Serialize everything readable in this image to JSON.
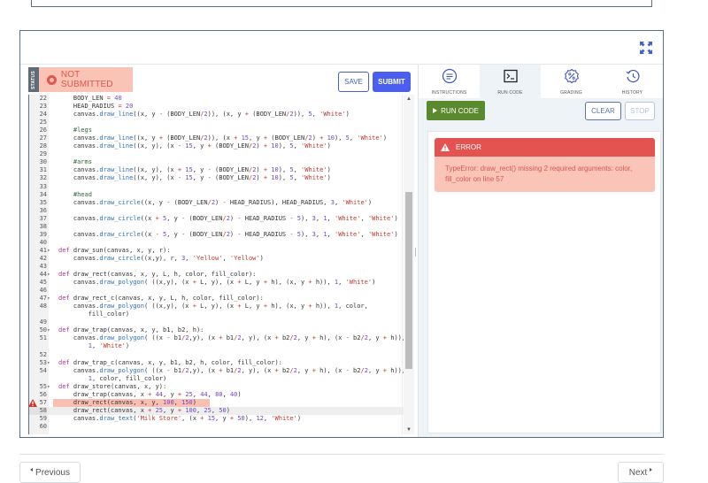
{
  "workspace": {
    "expand_icon": "expand-arrows-icon"
  },
  "editor": {
    "status_label": "STATUS",
    "status_text": "NOT SUBMITTED",
    "save_label": "SAVE",
    "submit_label": "SUBMIT",
    "error_line": 57,
    "active_line": 58,
    "lines": [
      {
        "n": "22",
        "fold": false,
        "html": "    BODY_LEN <span class='op'>=</span> <span class='num'>40</span>"
      },
      {
        "n": "23",
        "fold": false,
        "html": "    HEAD_RADIUS <span class='op'>=</span> <span class='num'>20</span>"
      },
      {
        "n": "24",
        "fold": false,
        "html": "    canvas.<span class='fn'>draw_line</span>((x, y <span class='op'>-</span> (BODY_LEN<span class='op'>/</span><span class='num'>2</span>)), (x, y <span class='op'>+</span> (BODY_LEN<span class='op'>/</span><span class='num'>2</span>)), <span class='num'>5</span>, <span class='str'>'White'</span>)"
      },
      {
        "n": "25",
        "fold": false,
        "html": ""
      },
      {
        "n": "26",
        "fold": false,
        "html": "    <span class='cm'>#legs</span>"
      },
      {
        "n": "27",
        "fold": false,
        "html": "    canvas.<span class='fn'>draw_line</span>((x, y <span class='op'>+</span> (BODY_LEN<span class='op'>/</span><span class='num'>2</span>)), (x <span class='op'>+</span> <span class='num'>15</span>, y <span class='op'>+</span> (BODY_LEN<span class='op'>/</span><span class='num'>2</span>) <span class='op'>+</span> <span class='num'>10</span>), <span class='num'>5</span>, <span class='str'>'White'</span>)"
      },
      {
        "n": "28",
        "fold": false,
        "html": "    canvas.<span class='fn'>draw_line</span>((x, y), (x <span class='op'>-</span> <span class='num'>15</span>, y <span class='op'>+</span> (BODY_LEN<span class='op'>/</span><span class='num'>2</span>) <span class='op'>+</span> <span class='num'>10</span>), <span class='num'>5</span>, <span class='str'>'White'</span>)"
      },
      {
        "n": "29",
        "fold": false,
        "html": ""
      },
      {
        "n": "30",
        "fold": false,
        "html": "    <span class='cm'>#arms</span>"
      },
      {
        "n": "31",
        "fold": false,
        "html": "    canvas.<span class='fn'>draw_line</span>((x, y), (x <span class='op'>+</span> <span class='num'>15</span>, y <span class='op'>-</span> (BODY_LEN<span class='op'>/</span><span class='num'>2</span>) <span class='op'>+</span> <span class='num'>10</span>), <span class='num'>5</span>, <span class='str'>'White'</span>)"
      },
      {
        "n": "32",
        "fold": false,
        "html": "    canvas.<span class='fn'>draw_line</span>((x, y), (x <span class='op'>-</span> <span class='num'>15</span>, y <span class='op'>-</span> (BODY_LEN<span class='op'>/</span><span class='num'>2</span>) <span class='op'>+</span> <span class='num'>10</span>), <span class='num'>5</span>, <span class='str'>'White'</span>)"
      },
      {
        "n": "33",
        "fold": false,
        "html": ""
      },
      {
        "n": "34",
        "fold": false,
        "html": "    <span class='cm'>#head</span>"
      },
      {
        "n": "35",
        "fold": false,
        "html": "    canvas.<span class='fn'>draw_circle</span>((x, y <span class='op'>-</span> (BODY_LEN<span class='op'>/</span><span class='num'>2</span>) <span class='op'>-</span> HEAD_RADIUS), HEAD_RADIUS, <span class='num'>3</span>, <span class='str'>'White'</span>)"
      },
      {
        "n": "36",
        "fold": false,
        "html": ""
      },
      {
        "n": "37",
        "fold": false,
        "html": "    canvas.<span class='fn'>draw_circle</span>((x <span class='op'>+</span> <span class='num'>5</span>, y <span class='op'>-</span> (BODY_LEN<span class='op'>/</span><span class='num'>2</span>) <span class='op'>-</span> HEAD_RADIUS <span class='op'>-</span> <span class='num'>5</span>), <span class='num'>3</span>, <span class='num'>1</span>, <span class='str'>'White'</span>, <span class='str'>'White'</span>)"
      },
      {
        "n": "38",
        "fold": false,
        "html": ""
      },
      {
        "n": "39",
        "fold": false,
        "html": "    canvas.<span class='fn'>draw_circle</span>((x <span class='op'>-</span> <span class='num'>5</span>, y <span class='op'>-</span> (BODY_LEN<span class='op'>/</span><span class='num'>2</span>) <span class='op'>-</span> HEAD_RADIUS <span class='op'>-</span> <span class='num'>5</span>), <span class='num'>3</span>, <span class='num'>1</span>, <span class='str'>'White'</span>, <span class='str'>'White'</span>)"
      },
      {
        "n": "40",
        "fold": false,
        "html": ""
      },
      {
        "n": "41",
        "fold": true,
        "html": "<span class='kw'>def</span> draw_sun(canvas, x, y, r):"
      },
      {
        "n": "42",
        "fold": false,
        "html": "    canvas.<span class='fn'>draw_circle</span>((x,y), r, <span class='num'>3</span>, <span class='str'>'Yellow'</span>, <span class='str'>'Yellow'</span>)"
      },
      {
        "n": "43",
        "fold": false,
        "html": ""
      },
      {
        "n": "44",
        "fold": true,
        "html": "<span class='kw'>def</span> draw_rect(canvas, x, y, L, h, color, fill_color):"
      },
      {
        "n": "45",
        "fold": false,
        "html": "    canvas.<span class='fn'>draw_polygon</span>( ((x,y), (x <span class='op'>+</span> L, y), (x <span class='op'>+</span> L, y <span class='op'>+</span> h), (x, y <span class='op'>+</span> h)), <span class='num'>1</span>, <span class='str'>'White'</span>)"
      },
      {
        "n": "46",
        "fold": false,
        "html": ""
      },
      {
        "n": "47",
        "fold": true,
        "html": "<span class='kw'>def</span> draw_rect_c(canvas, x, y, L, h, color, fill_color):"
      },
      {
        "n": "48",
        "fold": false,
        "html": "    canvas.<span class='fn'>draw_polygon</span>( ((x,y), (x <span class='op'>+</span> L, y), (x <span class='op'>+</span> L, y <span class='op'>+</span> h), (x, y <span class='op'>+</span> h)), <span class='num'>1</span>, color,"
      },
      {
        "n": "",
        "fold": false,
        "html": "        fill_color)"
      },
      {
        "n": "49",
        "fold": false,
        "html": ""
      },
      {
        "n": "50",
        "fold": true,
        "html": "<span class='kw'>def</span> draw_trap(canvas, x, y, b1, b2, h):"
      },
      {
        "n": "51",
        "fold": false,
        "html": "    canvas.<span class='fn'>draw_polygon</span>( ((x <span class='op'>-</span> b1<span class='op'>/</span><span class='num'>2</span>,y), (x <span class='op'>+</span> b1<span class='op'>/</span><span class='num'>2</span>, y), (x <span class='op'>+</span> b2<span class='op'>/</span><span class='num'>2</span>, y <span class='op'>+</span> h), (x <span class='op'>-</span> b2<span class='op'>/</span><span class='num'>2</span>, y <span class='op'>+</span> h)),"
      },
      {
        "n": "",
        "fold": false,
        "html": "        <span class='num'>1</span>, <span class='str'>'White'</span>)"
      },
      {
        "n": "52",
        "fold": false,
        "html": ""
      },
      {
        "n": "53",
        "fold": true,
        "html": "<span class='kw'>def</span> draw_trap_c(canvas, x, y, b1, b2, h, color, fill_color):"
      },
      {
        "n": "54",
        "fold": false,
        "html": "    canvas.<span class='fn'>draw_polygon</span>( ((x <span class='op'>-</span> b1<span class='op'>/</span><span class='num'>2</span>,y), (x <span class='op'>+</span> b1<span class='op'>/</span><span class='num'>2</span>, y), (x <span class='op'>+</span> b2<span class='op'>/</span><span class='num'>2</span>, y <span class='op'>+</span> h), (x <span class='op'>-</span> b2<span class='op'>/</span><span class='num'>2</span>, y <span class='op'>+</span> h)),"
      },
      {
        "n": "",
        "fold": false,
        "html": "        <span class='num'>1</span>, color, fill_color)"
      },
      {
        "n": "55",
        "fold": true,
        "html": "<span class='kw'>def</span> draw_store(canvas, x, y):"
      },
      {
        "n": "56",
        "fold": false,
        "html": "    draw_trap(canvas, x <span class='op'>+</span> <span class='num'>44</span>, y <span class='op'>+</span> <span class='num'>25</span>, <span class='num'>44</span>, <span class='num'>80</span>, <span class='num'>40</span>)"
      },
      {
        "n": "57",
        "fold": false,
        "html": "    draw_rect(canvas, x, y, <span class='num'>100</span>, <span class='num'>150</span>)"
      },
      {
        "n": "58",
        "fold": false,
        "html": "    draw_rect(canvas, x <span class='op'>+</span> <span class='num'>25</span>, y <span class='op'>+</span> <span class='num'>100</span>, <span class='num'>25</span>, <span class='num'>50</span>)"
      },
      {
        "n": "59",
        "fold": false,
        "html": "    canvas.<span class='fn'>draw_text</span>(<span class='str'>'Milk Store'</span>, (x <span class='op'>+</span> <span class='num'>15</span>, y <span class='op'>+</span> <span class='num'>50</span>), <span class='num'>12</span>, <span class='str'>'White'</span>)"
      },
      {
        "n": "60",
        "fold": false,
        "html": ""
      }
    ]
  },
  "panel": {
    "tabs": [
      {
        "label": "INSTRUCTIONS",
        "icon": "instructions-icon",
        "active": false
      },
      {
        "label": "RUN CODE",
        "icon": "terminal-icon",
        "active": true
      },
      {
        "label": "GRADING",
        "icon": "grading-percent-icon",
        "active": false
      },
      {
        "label": "HISTORY",
        "icon": "history-icon",
        "active": false
      }
    ],
    "run_label": "RUN CODE",
    "clear_label": "CLEAR",
    "stop_label": "STOP",
    "error": {
      "title": "ERROR",
      "message": "TypeError: draw_rect() missing 2 required arguments: color, fill_color on line 57"
    }
  },
  "pagination": {
    "prev_label": "Previous",
    "next_label": "Next"
  },
  "colors": {
    "accent": "#4a5ef0",
    "run_green": "#5b8a2e",
    "error_red": "#e55350",
    "error_bg": "#fbc4b8",
    "status_bg": "#f9c3b6"
  }
}
